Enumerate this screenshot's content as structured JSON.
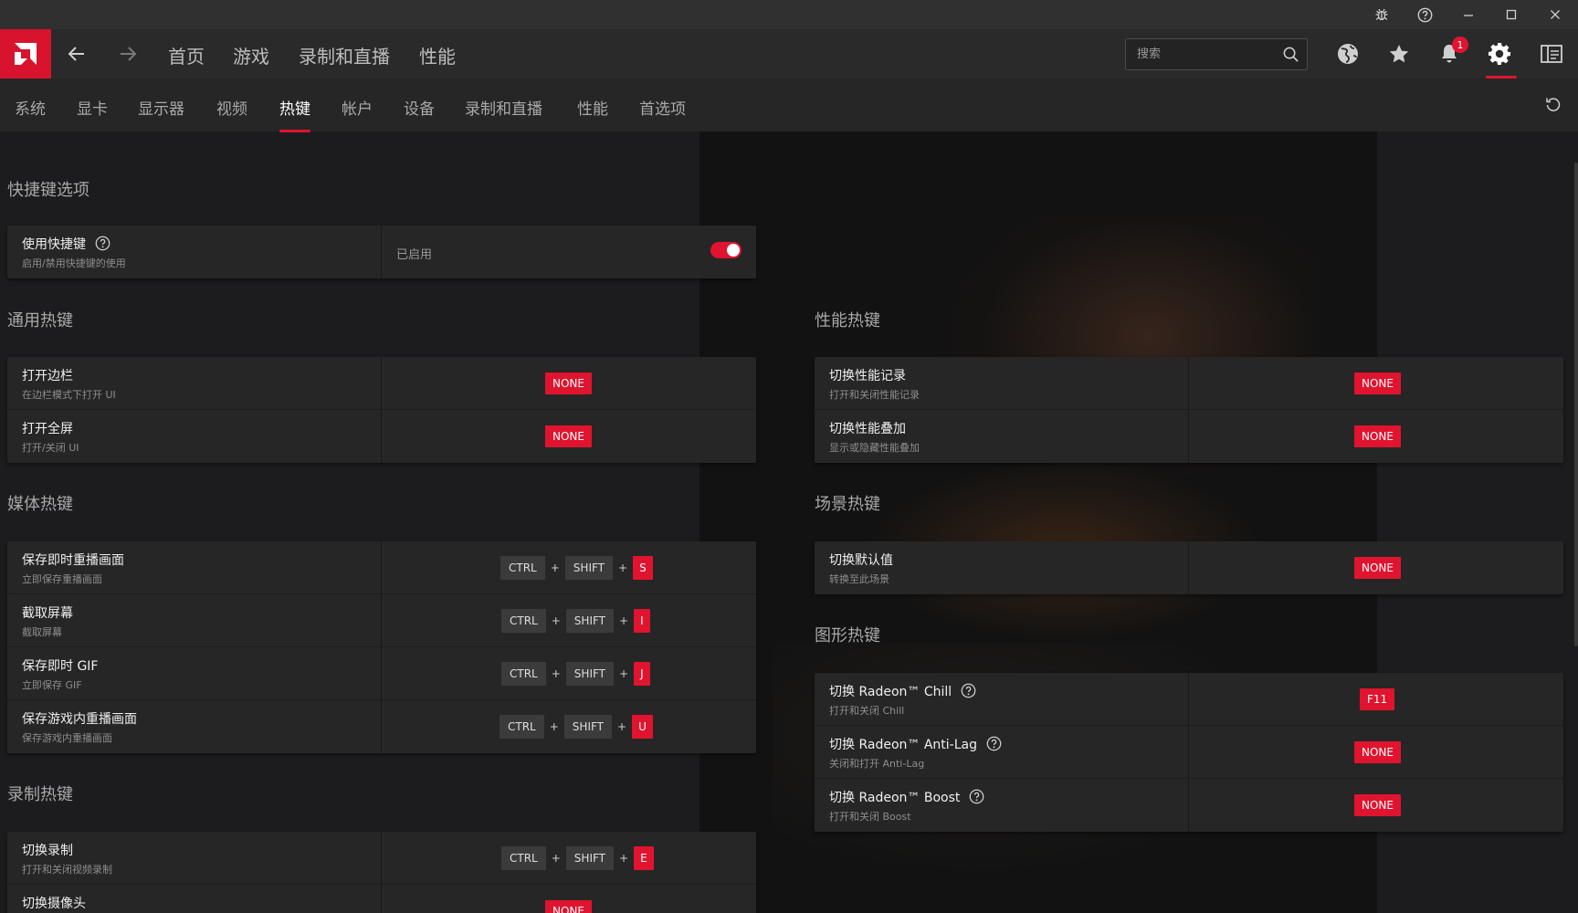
{
  "titlebar": {
    "bug_icon": "bug-icon",
    "help_icon": "help-icon",
    "minimize_icon": "minimize-icon",
    "maximize_icon": "maximize-icon",
    "close_icon": "close-icon"
  },
  "header": {
    "tabs": [
      {
        "label": "首页"
      },
      {
        "label": "游戏"
      },
      {
        "label": "录制和直播"
      },
      {
        "label": "性能"
      }
    ],
    "search_placeholder": "搜索",
    "notification_count": "1"
  },
  "subtabs": [
    {
      "label": "系统"
    },
    {
      "label": "显卡"
    },
    {
      "label": "显示器"
    },
    {
      "label": "视频"
    },
    {
      "label": "热键",
      "active": true
    },
    {
      "label": "帐户"
    },
    {
      "label": "设备"
    },
    {
      "label": "录制和直播"
    },
    {
      "label": "性能"
    },
    {
      "label": "首选项"
    }
  ],
  "shortcut_options": {
    "title": "快捷键选项",
    "row": {
      "title": "使用快捷键",
      "subtitle": "启用/禁用快捷键的使用",
      "status": "已启用",
      "enabled": true
    }
  },
  "general": {
    "title": "通用热键",
    "rows": [
      {
        "title": "打开边栏",
        "subtitle": "在边栏模式下打开 UI",
        "key": "NONE"
      },
      {
        "title": "打开全屏",
        "subtitle": "打开/关闭 UI",
        "key": "NONE"
      }
    ]
  },
  "media": {
    "title": "媒体热键",
    "rows": [
      {
        "title": "保存即时重播画面",
        "subtitle": "立即保存重播画面",
        "k1": "CTRL",
        "k2": "SHIFT",
        "k3": "S"
      },
      {
        "title": "截取屏幕",
        "subtitle": "截取屏幕",
        "k1": "CTRL",
        "k2": "SHIFT",
        "k3": "I"
      },
      {
        "title": "保存即时 GIF",
        "subtitle": "立即保存 GIF",
        "k1": "CTRL",
        "k2": "SHIFT",
        "k3": "J"
      },
      {
        "title": "保存游戏内重播画面",
        "subtitle": "保存游戏内重播画面",
        "k1": "CTRL",
        "k2": "SHIFT",
        "k3": "U"
      }
    ]
  },
  "recording": {
    "title": "录制热键",
    "rows": [
      {
        "title": "切换录制",
        "subtitle": "打开和关闭视频录制",
        "k1": "CTRL",
        "k2": "SHIFT",
        "k3": "E"
      },
      {
        "title": "切换摄像头",
        "subtitle": "",
        "key": "NONE"
      }
    ]
  },
  "performance": {
    "title": "性能热键",
    "rows": [
      {
        "title": "切换性能记录",
        "subtitle": "打开和关闭性能记录",
        "key": "NONE"
      },
      {
        "title": "切换性能叠加",
        "subtitle": "显示或隐藏性能叠加",
        "key": "NONE"
      }
    ]
  },
  "scene": {
    "title": "场景热键",
    "rows": [
      {
        "title": "切换默认值",
        "subtitle": "转换至此场景",
        "key": "NONE"
      }
    ]
  },
  "graphics": {
    "title": "图形热键",
    "rows": [
      {
        "title": "切换 Radeon™ Chill",
        "subtitle": "打开和关闭 Chill",
        "key": "F11"
      },
      {
        "title": "切换 Radeon™ Anti-Lag",
        "subtitle": "关闭和打开 Anti-Lag",
        "key": "NONE"
      },
      {
        "title": "切换 Radeon™ Boost",
        "subtitle": "打开和关闭 Boost",
        "key": "NONE"
      }
    ]
  },
  "colors": {
    "accent": "#e0142f",
    "background": "#1c1c1e",
    "panel": "#262626"
  }
}
